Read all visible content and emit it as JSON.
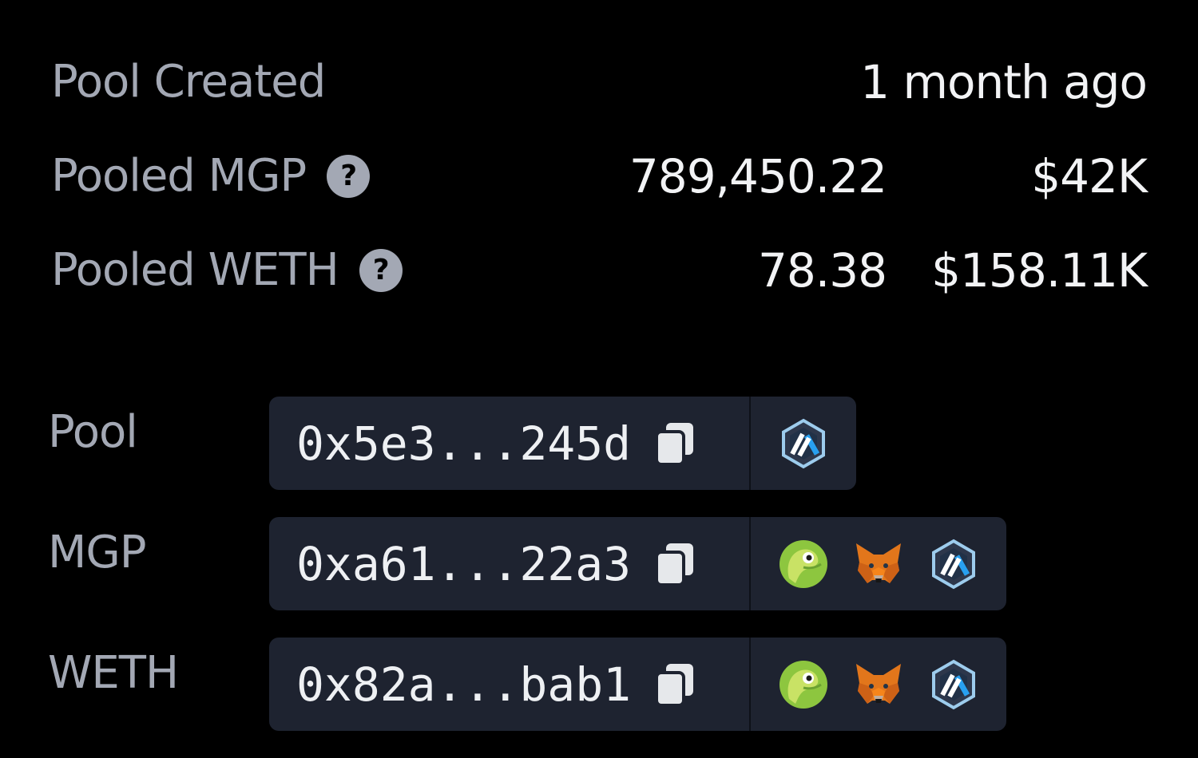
{
  "stats": [
    {
      "label": "Pool Created",
      "value": "1 month ago",
      "has_help": false
    },
    {
      "label": "Pooled MGP",
      "amount": "789,450.22",
      "usd": "$42K",
      "has_help": true
    },
    {
      "label": "Pooled WETH",
      "amount": "78.38",
      "usd": "$158.11K",
      "has_help": true
    }
  ],
  "help_glyph": "?",
  "addresses": [
    {
      "label": "Pool",
      "address": "0x5e3...245d",
      "links": [
        "arbiscan-icon"
      ]
    },
    {
      "label": "MGP",
      "address": "0xa61...22a3",
      "links": [
        "coingecko-icon",
        "metamask-icon",
        "arbiscan-icon"
      ]
    },
    {
      "label": "WETH",
      "address": "0x82a...bab1",
      "links": [
        "coingecko-icon",
        "metamask-icon",
        "arbiscan-icon"
      ]
    }
  ],
  "colors": {
    "background": "#000000",
    "label": "#a3a8b4",
    "value": "#f2f3f5",
    "pill": "#1e2330"
  }
}
